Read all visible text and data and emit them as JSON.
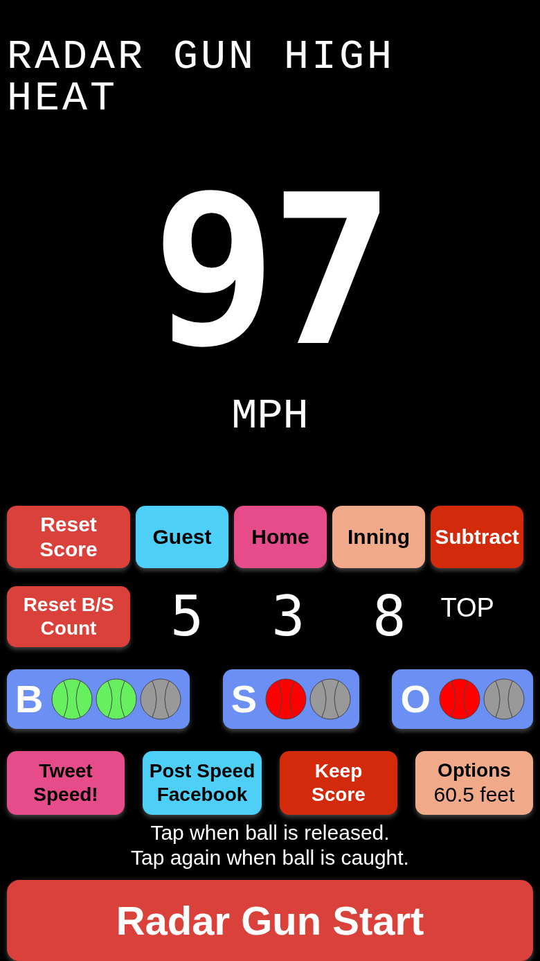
{
  "title": "RADAR GUN HIGH HEAT",
  "speed": {
    "value": "97",
    "unit": "MPH"
  },
  "top_buttons": [
    {
      "label": "Reset\nScore",
      "color": "#d9413a"
    },
    {
      "label": "Guest",
      "color": "#4dcff8"
    },
    {
      "label": "Home",
      "color": "#e64b8a"
    },
    {
      "label": "Inning",
      "color": "#f0aa8a"
    },
    {
      "label": "Subtract",
      "color": "#d42a0c"
    }
  ],
  "reset_count_button": {
    "label": "Reset B/S\nCount",
    "color": "#d9413a"
  },
  "scores": {
    "guest": "5",
    "home": "3",
    "inning": "8",
    "half": "TOP"
  },
  "counts": [
    {
      "letter": "B",
      "color": "#66f060",
      "balls": [
        {
          "on": true
        },
        {
          "on": true
        },
        {
          "on": false
        }
      ]
    },
    {
      "letter": "S",
      "color": "#ff0000",
      "balls": [
        {
          "on": true
        },
        {
          "on": false
        }
      ]
    },
    {
      "letter": "O",
      "color": "#ff0000",
      "balls": [
        {
          "on": true
        },
        {
          "on": false
        }
      ]
    }
  ],
  "bottom_buttons": [
    {
      "label": "Tweet\nSpeed!",
      "color": "#e64b8a"
    },
    {
      "label": "Post Speed\nFacebook",
      "color": "#4dcff8"
    },
    {
      "label": "Keep\nScore",
      "color": "#d42a0c"
    },
    {
      "label": "Options",
      "sublabel": "60.5 feet",
      "color": "#f0aa8a"
    }
  ],
  "instructions": [
    "Tap when ball is released.",
    "Tap again when ball is caught."
  ],
  "start_button": {
    "label": "Radar Gun Start",
    "color": "#d9413a"
  }
}
